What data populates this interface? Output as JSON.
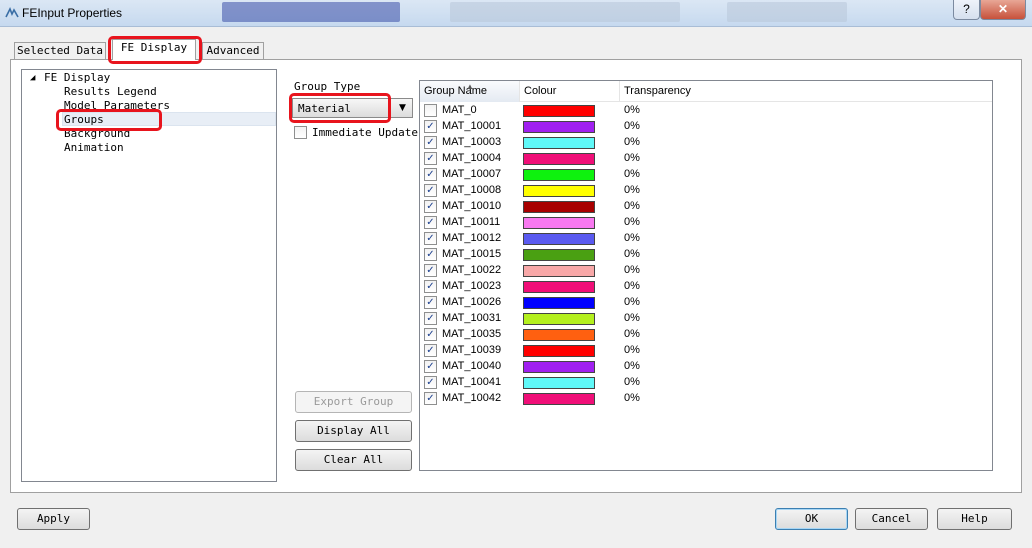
{
  "window": {
    "title": "FEInput Properties",
    "help_label": "?",
    "close_label": "✕"
  },
  "tabs": [
    {
      "label": "Selected Data"
    },
    {
      "label": "FE Display"
    },
    {
      "label": "Advanced"
    }
  ],
  "tree": {
    "root": "FE Display",
    "items": [
      "Results Legend",
      "Model Parameters",
      "Groups",
      "Background",
      "Animation"
    ],
    "selected": "Groups"
  },
  "group_type": {
    "label": "Group Type",
    "selected": "Material"
  },
  "immediate_update": {
    "label": "Immediate Update",
    "checked": false
  },
  "buttons": {
    "export_group": "Export Group",
    "display_all": "Display All",
    "clear_all": "Clear All",
    "apply": "Apply",
    "ok": "OK",
    "cancel": "Cancel",
    "help": "Help"
  },
  "list": {
    "columns": [
      "Group Name",
      "Colour",
      "Transparency"
    ],
    "rows": [
      {
        "name": "MAT_0",
        "checked": false,
        "color": "#ff0000",
        "transparency": "0%"
      },
      {
        "name": "MAT_10001",
        "checked": true,
        "color": "#a020f0",
        "transparency": "0%"
      },
      {
        "name": "MAT_10003",
        "checked": true,
        "color": "#5ff8f8",
        "transparency": "0%"
      },
      {
        "name": "MAT_10004",
        "checked": true,
        "color": "#f00f78",
        "transparency": "0%"
      },
      {
        "name": "MAT_10007",
        "checked": true,
        "color": "#0ef20e",
        "transparency": "0%"
      },
      {
        "name": "MAT_10008",
        "checked": true,
        "color": "#ffff00",
        "transparency": "0%"
      },
      {
        "name": "MAT_10010",
        "checked": true,
        "color": "#a80000",
        "transparency": "0%"
      },
      {
        "name": "MAT_10011",
        "checked": true,
        "color": "#f878f0",
        "transparency": "0%"
      },
      {
        "name": "MAT_10012",
        "checked": true,
        "color": "#5a5af0",
        "transparency": "0%"
      },
      {
        "name": "MAT_10015",
        "checked": true,
        "color": "#4aa012",
        "transparency": "0%"
      },
      {
        "name": "MAT_10022",
        "checked": true,
        "color": "#f8a8a8",
        "transparency": "0%"
      },
      {
        "name": "MAT_10023",
        "checked": true,
        "color": "#f00f78",
        "transparency": "0%"
      },
      {
        "name": "MAT_10026",
        "checked": true,
        "color": "#0000ff",
        "transparency": "0%"
      },
      {
        "name": "MAT_10031",
        "checked": true,
        "color": "#b4f01e",
        "transparency": "0%"
      },
      {
        "name": "MAT_10035",
        "checked": true,
        "color": "#ff6010",
        "transparency": "0%"
      },
      {
        "name": "MAT_10039",
        "checked": true,
        "color": "#ff0000",
        "transparency": "0%"
      },
      {
        "name": "MAT_10040",
        "checked": true,
        "color": "#a020f0",
        "transparency": "0%"
      },
      {
        "name": "MAT_10041",
        "checked": true,
        "color": "#5ff8f8",
        "transparency": "0%"
      },
      {
        "name": "MAT_10042",
        "checked": true,
        "color": "#f00f78",
        "transparency": "0%"
      }
    ]
  },
  "colors": {
    "highlight": "#e8141d",
    "title_gradient_top": "#dbe7f4",
    "checkmark": "#1b3f8f"
  }
}
